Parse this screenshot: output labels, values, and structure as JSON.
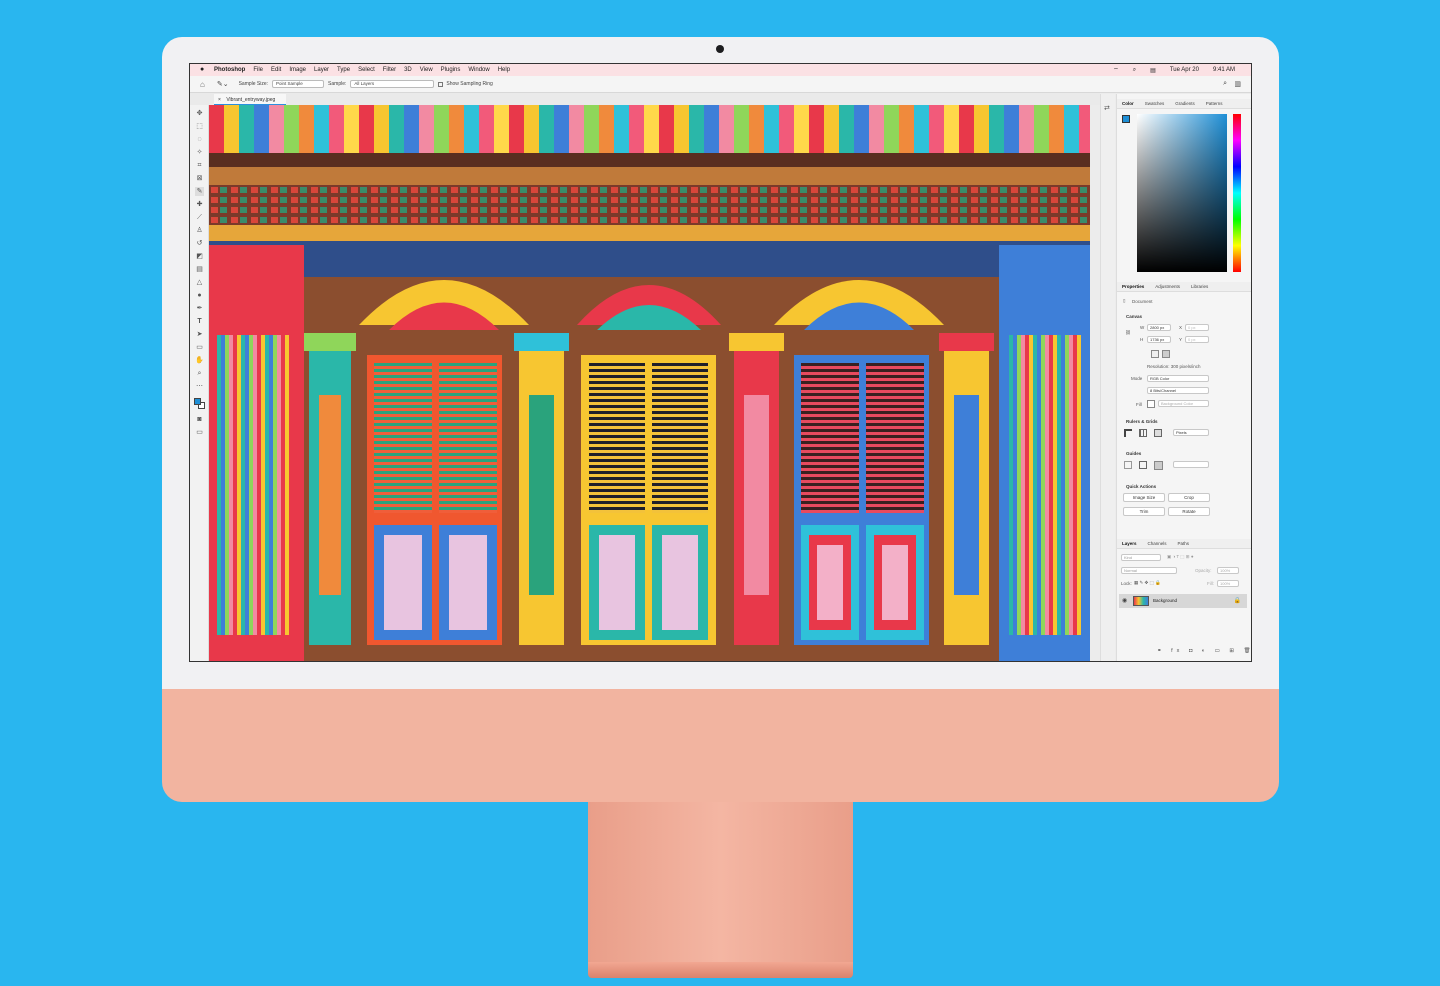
{
  "menubar": {
    "app": "Photoshop",
    "items": [
      "File",
      "Edit",
      "Image",
      "Layer",
      "Type",
      "Select",
      "Filter",
      "3D",
      "View",
      "Plugins",
      "Window",
      "Help"
    ],
    "date": "Tue Apr 20",
    "time": "9:41 AM"
  },
  "options": {
    "sample_size_label": "Sample Size:",
    "sample_size_value": "Point Sample",
    "sample_label": "Sample:",
    "sample_value": "All Layers",
    "sampling_ring_label": "Show Sampling Ring"
  },
  "document": {
    "tab_title": "Vibrant_entryway.jpeg"
  },
  "color_panel": {
    "tabs": [
      "Color",
      "Swatches",
      "Gradients",
      "Patterns"
    ],
    "fg_color": "#1e8fd6"
  },
  "properties_panel": {
    "tabs": [
      "Properties",
      "Adjustments",
      "Libraries"
    ],
    "doc_label": "Document",
    "canvas_header": "Canvas",
    "w_label": "W",
    "w_value": "2800 px",
    "h_label": "H",
    "h_value": "1736 px",
    "x_label": "X",
    "x_value": "0 px",
    "y_label": "Y",
    "y_value": "0 px",
    "resolution": "Resolution: 300 pixels/inch",
    "mode_label": "Mode",
    "mode_value": "RGB Color",
    "depth_value": "8 Bits/Channel",
    "fill_label": "Fill",
    "fill_value": "Background Color",
    "rulers_header": "Rulers & Grids",
    "rulers_unit": "Pixels",
    "guides_header": "Guides",
    "quick_header": "Quick Actions",
    "btn_image_size": "Image Size",
    "btn_crop": "Crop",
    "btn_trim": "Trim",
    "btn_rotate": "Rotate"
  },
  "layers_panel": {
    "tabs": [
      "Layers",
      "Channels",
      "Paths"
    ],
    "kind_label": "Kind",
    "blend_mode": "Normal",
    "opacity_label": "Opacity:",
    "opacity_value": "100%",
    "lock_label": "Lock:",
    "fill_label": "Fill:",
    "fill_value": "100%",
    "layers": [
      {
        "name": "Background",
        "visible": true,
        "locked": true
      }
    ]
  }
}
